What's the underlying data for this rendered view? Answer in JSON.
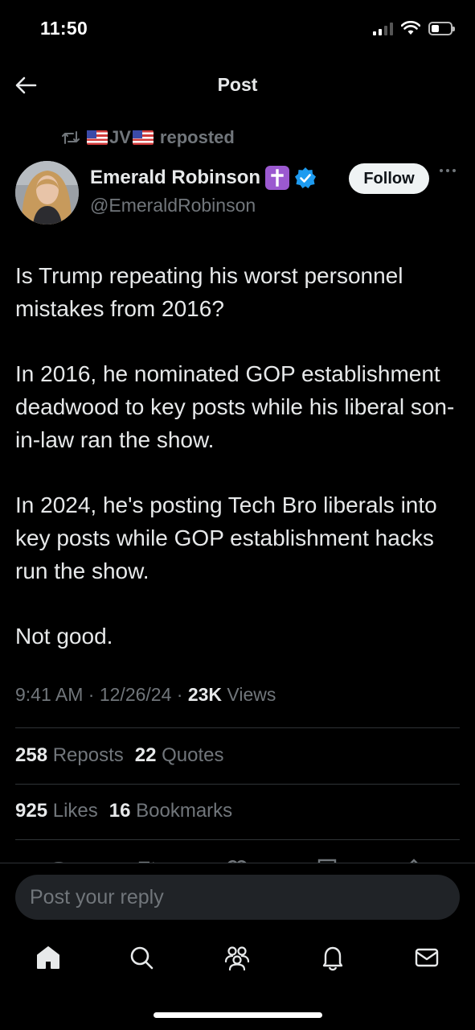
{
  "status_bar": {
    "time": "11:50"
  },
  "header": {
    "title": "Post"
  },
  "repost": {
    "user": "JV",
    "label": "reposted"
  },
  "author": {
    "name": "Emerald Robinson",
    "handle": "@EmeraldRobinson",
    "follow_label": "Follow"
  },
  "post": {
    "paragraphs": [
      "Is Trump repeating his worst personnel mistakes from 2016?",
      "In 2016, he nominated GOP establishment deadwood to key posts while his liberal son-in-law ran the show.",
      "In 2024, he's posting Tech Bro liberals into key posts while GOP establishment hacks run the show.",
      "Not good."
    ],
    "time": "9:41 AM",
    "sep": "·",
    "date": "12/26/24",
    "views_count": "23K",
    "views_label": "Views"
  },
  "stats": {
    "reposts_count": "258",
    "reposts_label": "Reposts",
    "quotes_count": "22",
    "quotes_label": "Quotes",
    "likes_count": "925",
    "likes_label": "Likes",
    "bookmarks_count": "16",
    "bookmarks_label": "Bookmarks"
  },
  "reply": {
    "placeholder": "Post your reply"
  },
  "tabs": [
    {
      "icon": "home-icon"
    },
    {
      "icon": "search-icon"
    },
    {
      "icon": "communities-icon"
    },
    {
      "icon": "notifications-icon"
    },
    {
      "icon": "messages-icon"
    }
  ],
  "colors": {
    "background": "#000000",
    "text": "#e7e9ea",
    "muted": "#71767b",
    "verified": "#1d9bf0",
    "badge": "#9b59d0"
  }
}
